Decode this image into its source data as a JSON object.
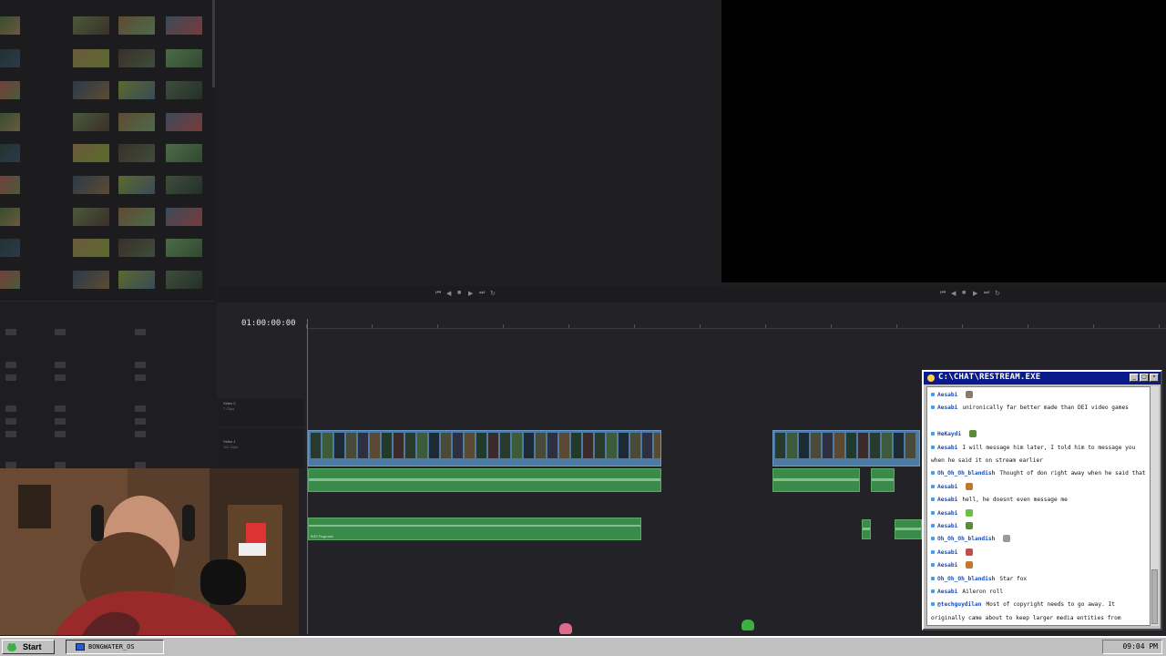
{
  "timeline": {
    "timecode": "01:00:00:00",
    "tracks": [
      {
        "name": "Video 2",
        "sub": "7 Clips"
      },
      {
        "name": "Video 1",
        "sub": "112 Clips"
      }
    ],
    "audio_clip_label": "SOG Frogs.wav"
  },
  "chat": {
    "title": "C:\\CHAT\\RESTREAM.EXE",
    "messages": [
      {
        "user": "Aesabi",
        "text": ""
      },
      {
        "user": "Aesabi",
        "text": "unironically far better made than DEI video games"
      },
      {
        "user": "HeKaydi",
        "text": ""
      },
      {
        "user": "Aesabi",
        "text": "I will message him later, I told him to message you when he said it on stream earlier"
      },
      {
        "user": "Oh_Oh_Oh_blandish",
        "text": "Thought of don right away when he said that."
      },
      {
        "user": "Aesabi",
        "text": ""
      },
      {
        "user": "Aesabi",
        "text": "hell, he doesnt even message me"
      },
      {
        "user": "Aesabi",
        "text": ""
      },
      {
        "user": "Aesabi",
        "text": ""
      },
      {
        "user": "Oh_Oh_Oh_blandish",
        "text": ""
      },
      {
        "user": "Aesabi",
        "text": ""
      },
      {
        "user": "Aesabi",
        "text": ""
      },
      {
        "user": "Oh_Oh_Oh_blandish",
        "text": "Star fox"
      },
      {
        "user": "Aesabi",
        "text": "Aileron roll"
      },
      {
        "user": "@techguydilan",
        "text": "Most of copyright needs to go away. It originally came about to keep larger media entities from stealing the ideas of smaller ones. But now the biggest ones are abusing it to shitstomp everyone."
      }
    ]
  },
  "taskbar": {
    "start_label": "Start",
    "task_label": "BONGWATER_OS",
    "clock": "09:04 PM"
  },
  "colors": {
    "titlebar": "#0a1a8a",
    "video_clip": "#4c7aa3",
    "audio_clip": "#3a8a4a",
    "playhead": "#e34"
  }
}
